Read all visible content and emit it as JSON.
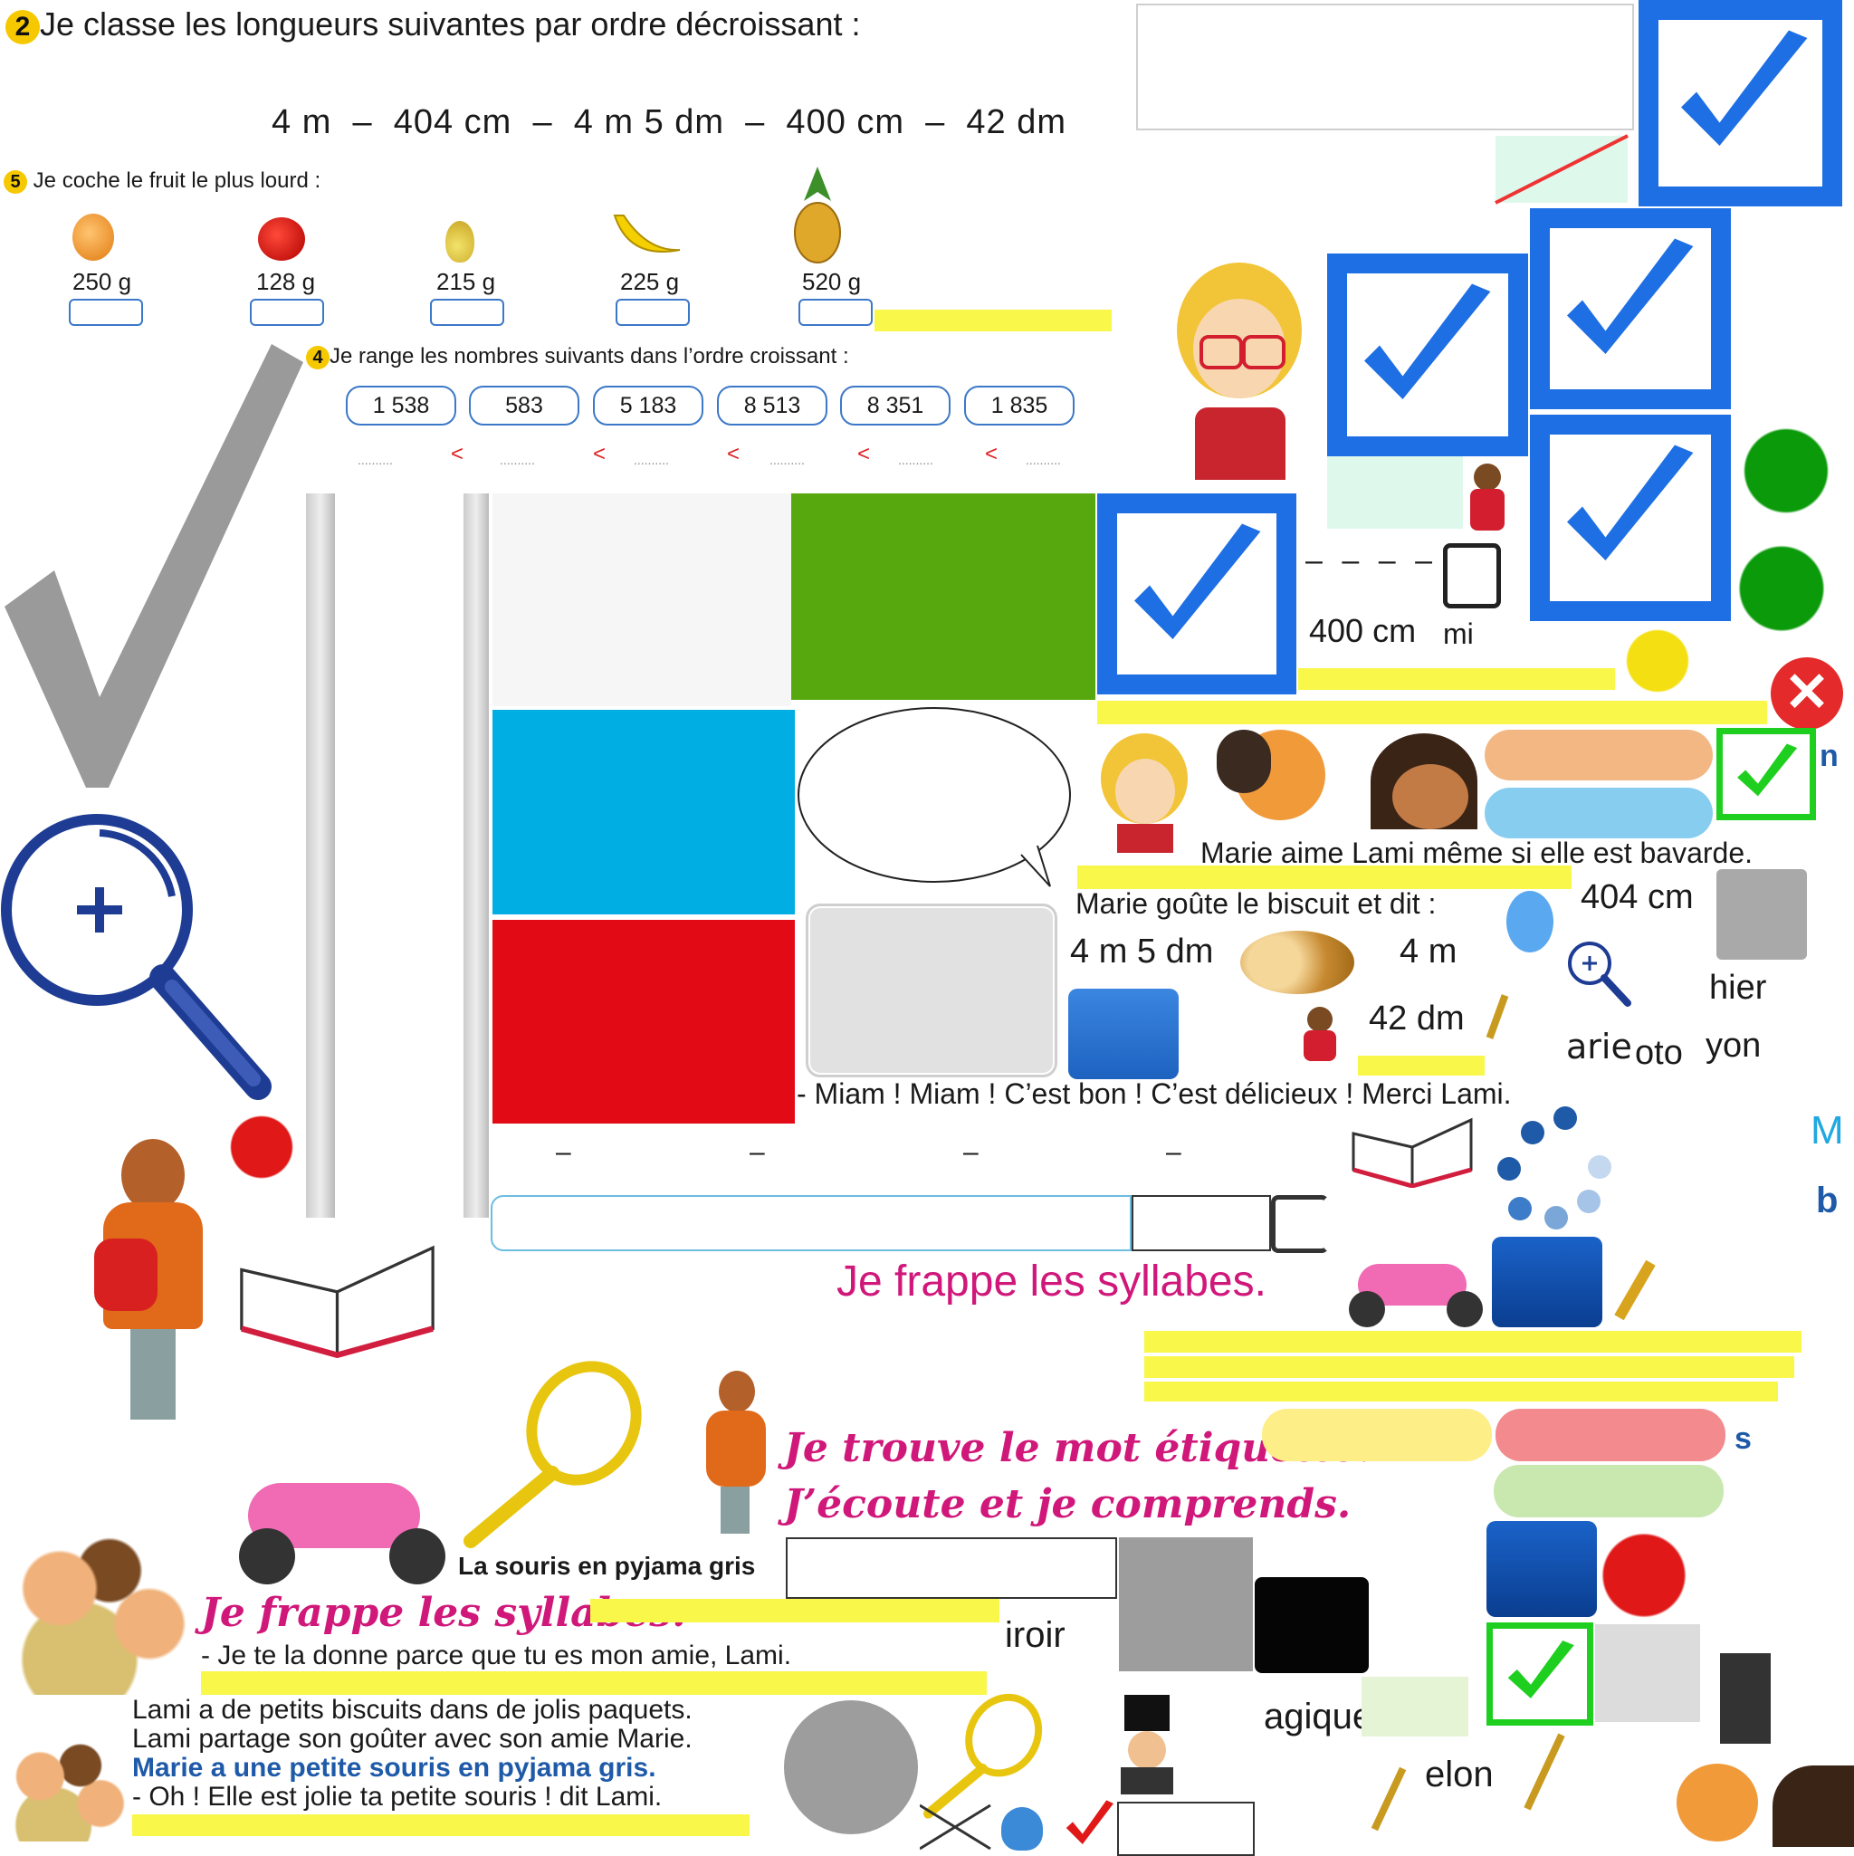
{
  "exercise2": {
    "number": "2",
    "instruction": "Je classe les longueurs suivantes par ordre décroissant :",
    "lengths": "4 m  –  404 cm  –  4 m 5 dm  –  400 cm  –  42 dm"
  },
  "exercise5": {
    "number": "5",
    "instruction": "Je coche le fruit le plus lourd :",
    "fruits": [
      {
        "name": "melon-icon",
        "weight": "250 g"
      },
      {
        "name": "apple-icon",
        "weight": "128 g"
      },
      {
        "name": "pear-icon",
        "weight": "215 g"
      },
      {
        "name": "banana-icon",
        "weight": "225 g"
      },
      {
        "name": "pineapple-icon",
        "weight": "520 g"
      }
    ]
  },
  "exercise4": {
    "number": "4",
    "instruction": "Je range les nombres suivants dans l’ordre croissant :",
    "numbers": [
      "1 538",
      "583",
      "5 183",
      "8 513",
      "8 351",
      "1 835"
    ],
    "dots": "..........",
    "symbol": "<"
  },
  "fragments": {
    "dash_line": "– – – –",
    "len_400": "400 cm",
    "mi": "mi",
    "len_404": "404 cm",
    "len_4m5dm": "4 m 5 dm",
    "len_4m": "4 m",
    "len_42dm": "42 dm",
    "hier": "hier",
    "arie": "arie",
    "oto": "oto",
    "yon": "yon",
    "iroir": "iroir",
    "agique": "agique",
    "elon": "elon",
    "letter_n": "n",
    "letter_M": "M",
    "letter_b": "b",
    "letter_s": "s",
    "dash": "–"
  },
  "story": {
    "line_marie_aime": "Marie aime Lami même si elle est bavarde.",
    "line_marie_goute": "Marie goûte le biscuit et dit :",
    "line_miam": "- Miam ! Miam ! C’est bon ! C’est  délicieux ! Merci Lami.",
    "line_donne": "- Je te la donne parce que tu es mon amie, Lami.",
    "line_biscuits": "Lami a de petits biscuits dans de jolis paquets.",
    "line_partage": "Lami partage son goûter avec son amie Marie.",
    "line_souris": "Marie a une petite souris en pyjama gris.",
    "line_oh": "- Oh ! Elle est jolie ta petite souris ! dit Lami.",
    "caption_souris": "La souris en pyjama gris"
  },
  "headings": {
    "frappe_syllabes_plain": "Je frappe les syllabes.",
    "trouve_mot": "Je trouve le mot étiquette.",
    "ecoute": "J’écoute et je comprends.",
    "frappe_syllabes_fancy": "Je frappe les syllabes."
  },
  "colors": {
    "check_blue": "#1e6fe3",
    "highlight_yellow": "#f8f74a",
    "green_block": "#57a80f",
    "cyan_block": "#00aee3",
    "red_block": "#e20a14",
    "heading_pink": "#d0177a",
    "check_green": "#1fcf1f"
  }
}
